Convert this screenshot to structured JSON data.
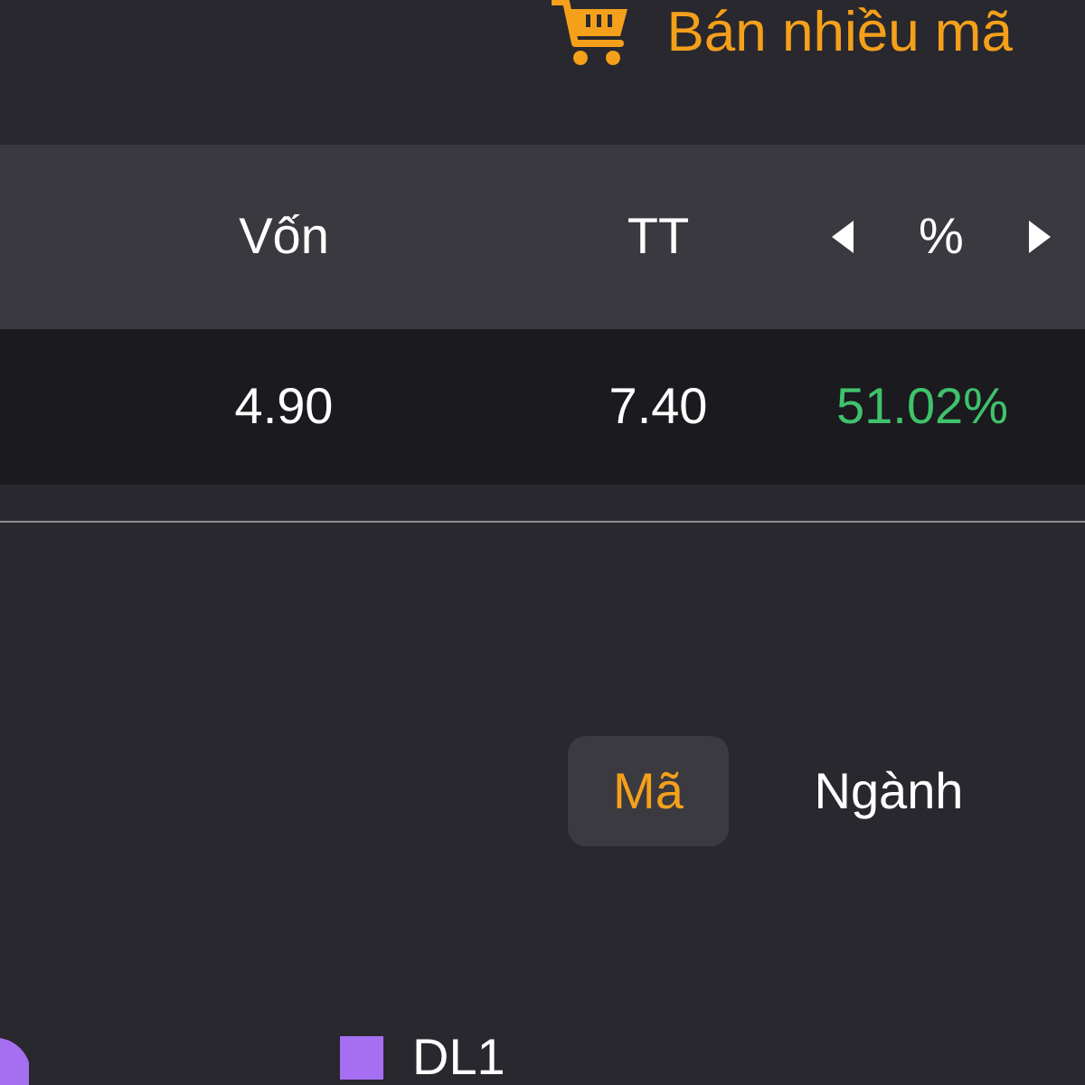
{
  "header": {
    "action": {
      "label": "Bán nhiều mã"
    }
  },
  "table": {
    "columns": [
      {
        "label": "Vốn",
        "kind": "text"
      },
      {
        "label": "TT",
        "kind": "text"
      },
      {
        "label": "%",
        "kind": "pager"
      }
    ],
    "rows": [
      {
        "cells": [
          "4.90",
          "7.40",
          "51.02%"
        ],
        "positive": true
      }
    ]
  },
  "view_toggle": [
    {
      "label": "Mã",
      "selected": true
    },
    {
      "label": "Ngành",
      "selected": false
    }
  ],
  "chart": {
    "legend": [
      {
        "label": "DL1",
        "color": "#a66ff2"
      }
    ]
  }
}
